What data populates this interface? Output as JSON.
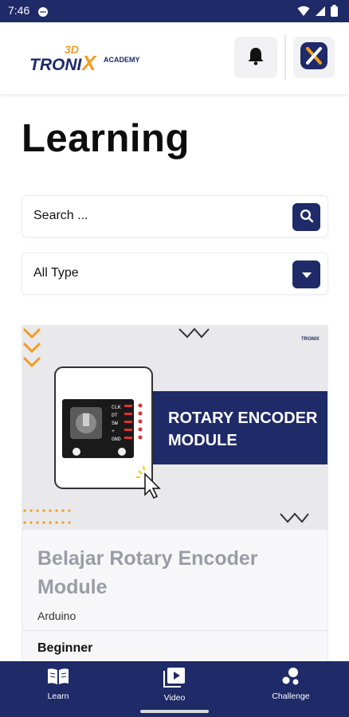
{
  "status_bar": {
    "time": "7:46",
    "icons": [
      "chat-notification-icon",
      "wifi-icon",
      "signal-icon",
      "battery-icon"
    ]
  },
  "app_bar": {
    "logo": {
      "text_top": "3D",
      "text_main": "TRONI",
      "text_x": "X",
      "text_side": "ACADEMY"
    },
    "notification_icon": "bell-icon",
    "app_icon": "tronix-x-icon"
  },
  "page": {
    "title": "Learning"
  },
  "search": {
    "placeholder": "Search ...",
    "button_icon": "search-icon"
  },
  "filter": {
    "selected": "All Type",
    "button_icon": "chevron-down-icon"
  },
  "course_card": {
    "banner": {
      "title_line1": "ROTARY ENCODER",
      "title_line2": "MODULE",
      "pins": [
        "CLK",
        "DT",
        "SW",
        "+",
        "GND"
      ],
      "corner_logo": "TRONIX"
    },
    "title": "Belajar Rotary Encoder Module",
    "category": "Arduino",
    "level": "Beginner"
  },
  "bottom_nav": {
    "items": [
      {
        "label": "Learn",
        "icon": "open-book-icon"
      },
      {
        "label": "Video",
        "icon": "video-play-icon"
      },
      {
        "label": "Challenge",
        "icon": "challenge-icon"
      }
    ]
  },
  "colors": {
    "primary": "#1f2a68",
    "accent_orange": "#f39c22",
    "logo_blue": "#1f2a68",
    "muted_title": "#9a9ca6"
  }
}
